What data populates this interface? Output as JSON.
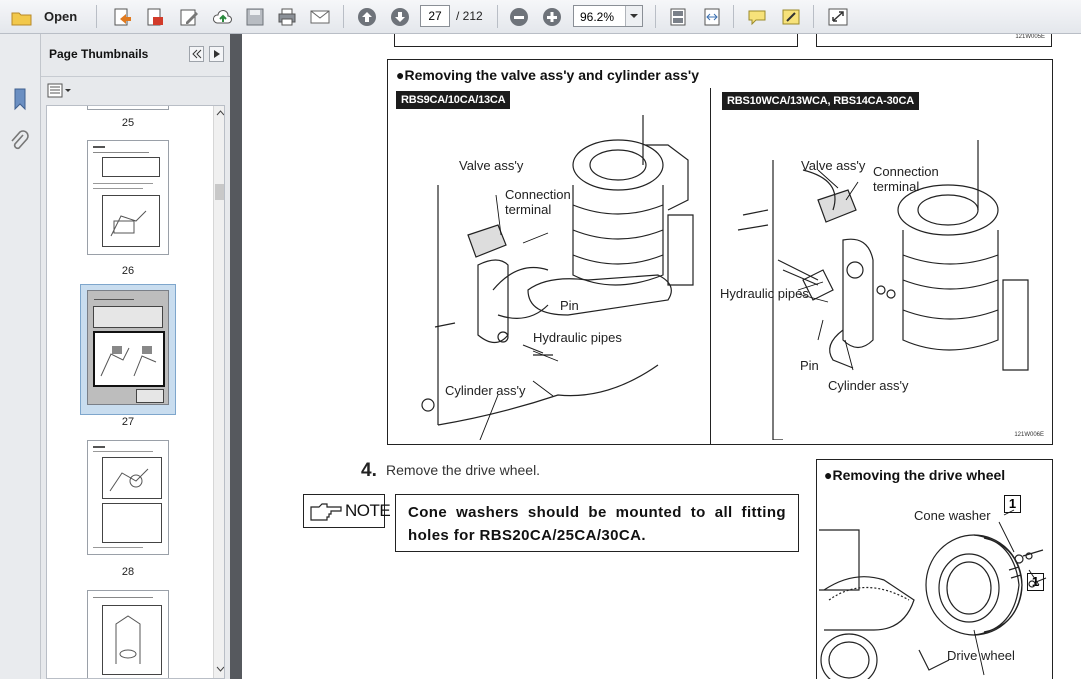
{
  "toolbar": {
    "open_label": "Open",
    "current_page": "27",
    "total_pages": "/ 212",
    "zoom": "96.2%"
  },
  "thumbnails": {
    "title": "Page Thumbnails",
    "pages": [
      "25",
      "26",
      "27",
      "28"
    ],
    "selected": "27"
  },
  "doc": {
    "top_box_code": "121W005E",
    "section_valve": {
      "title": "●Removing the valve ass'y and cylinder ass'y",
      "left_tag": "RBS9CA/10CA/13CA",
      "right_tag": "RBS10WCA/13WCA, RBS14CA-30CA",
      "left_labels": {
        "valve": "Valve ass'y",
        "connection": "Connection\nterminal",
        "pin": "Pin",
        "hydraulic": "Hydraulic pipes",
        "cylinder": "Cylinder ass'y"
      },
      "right_labels": {
        "valve": "Valve ass'y",
        "connection": "Connection\nterminal",
        "hydraulic": "Hydraulic pipes",
        "pin": "Pin",
        "cylinder": "Cylinder ass'y"
      },
      "code": "121W006E"
    },
    "step": {
      "number": "4.",
      "text": "Remove the drive wheel."
    },
    "note": {
      "label": "NOTE",
      "text": "Cone washers should be mounted to all fitting holes for RBS20CA/25CA/30CA."
    },
    "section_drive": {
      "title": "●Removing the drive wheel",
      "cone_washer": "Cone washer",
      "drive_wheel": "Drive wheel",
      "callout": "1"
    }
  }
}
